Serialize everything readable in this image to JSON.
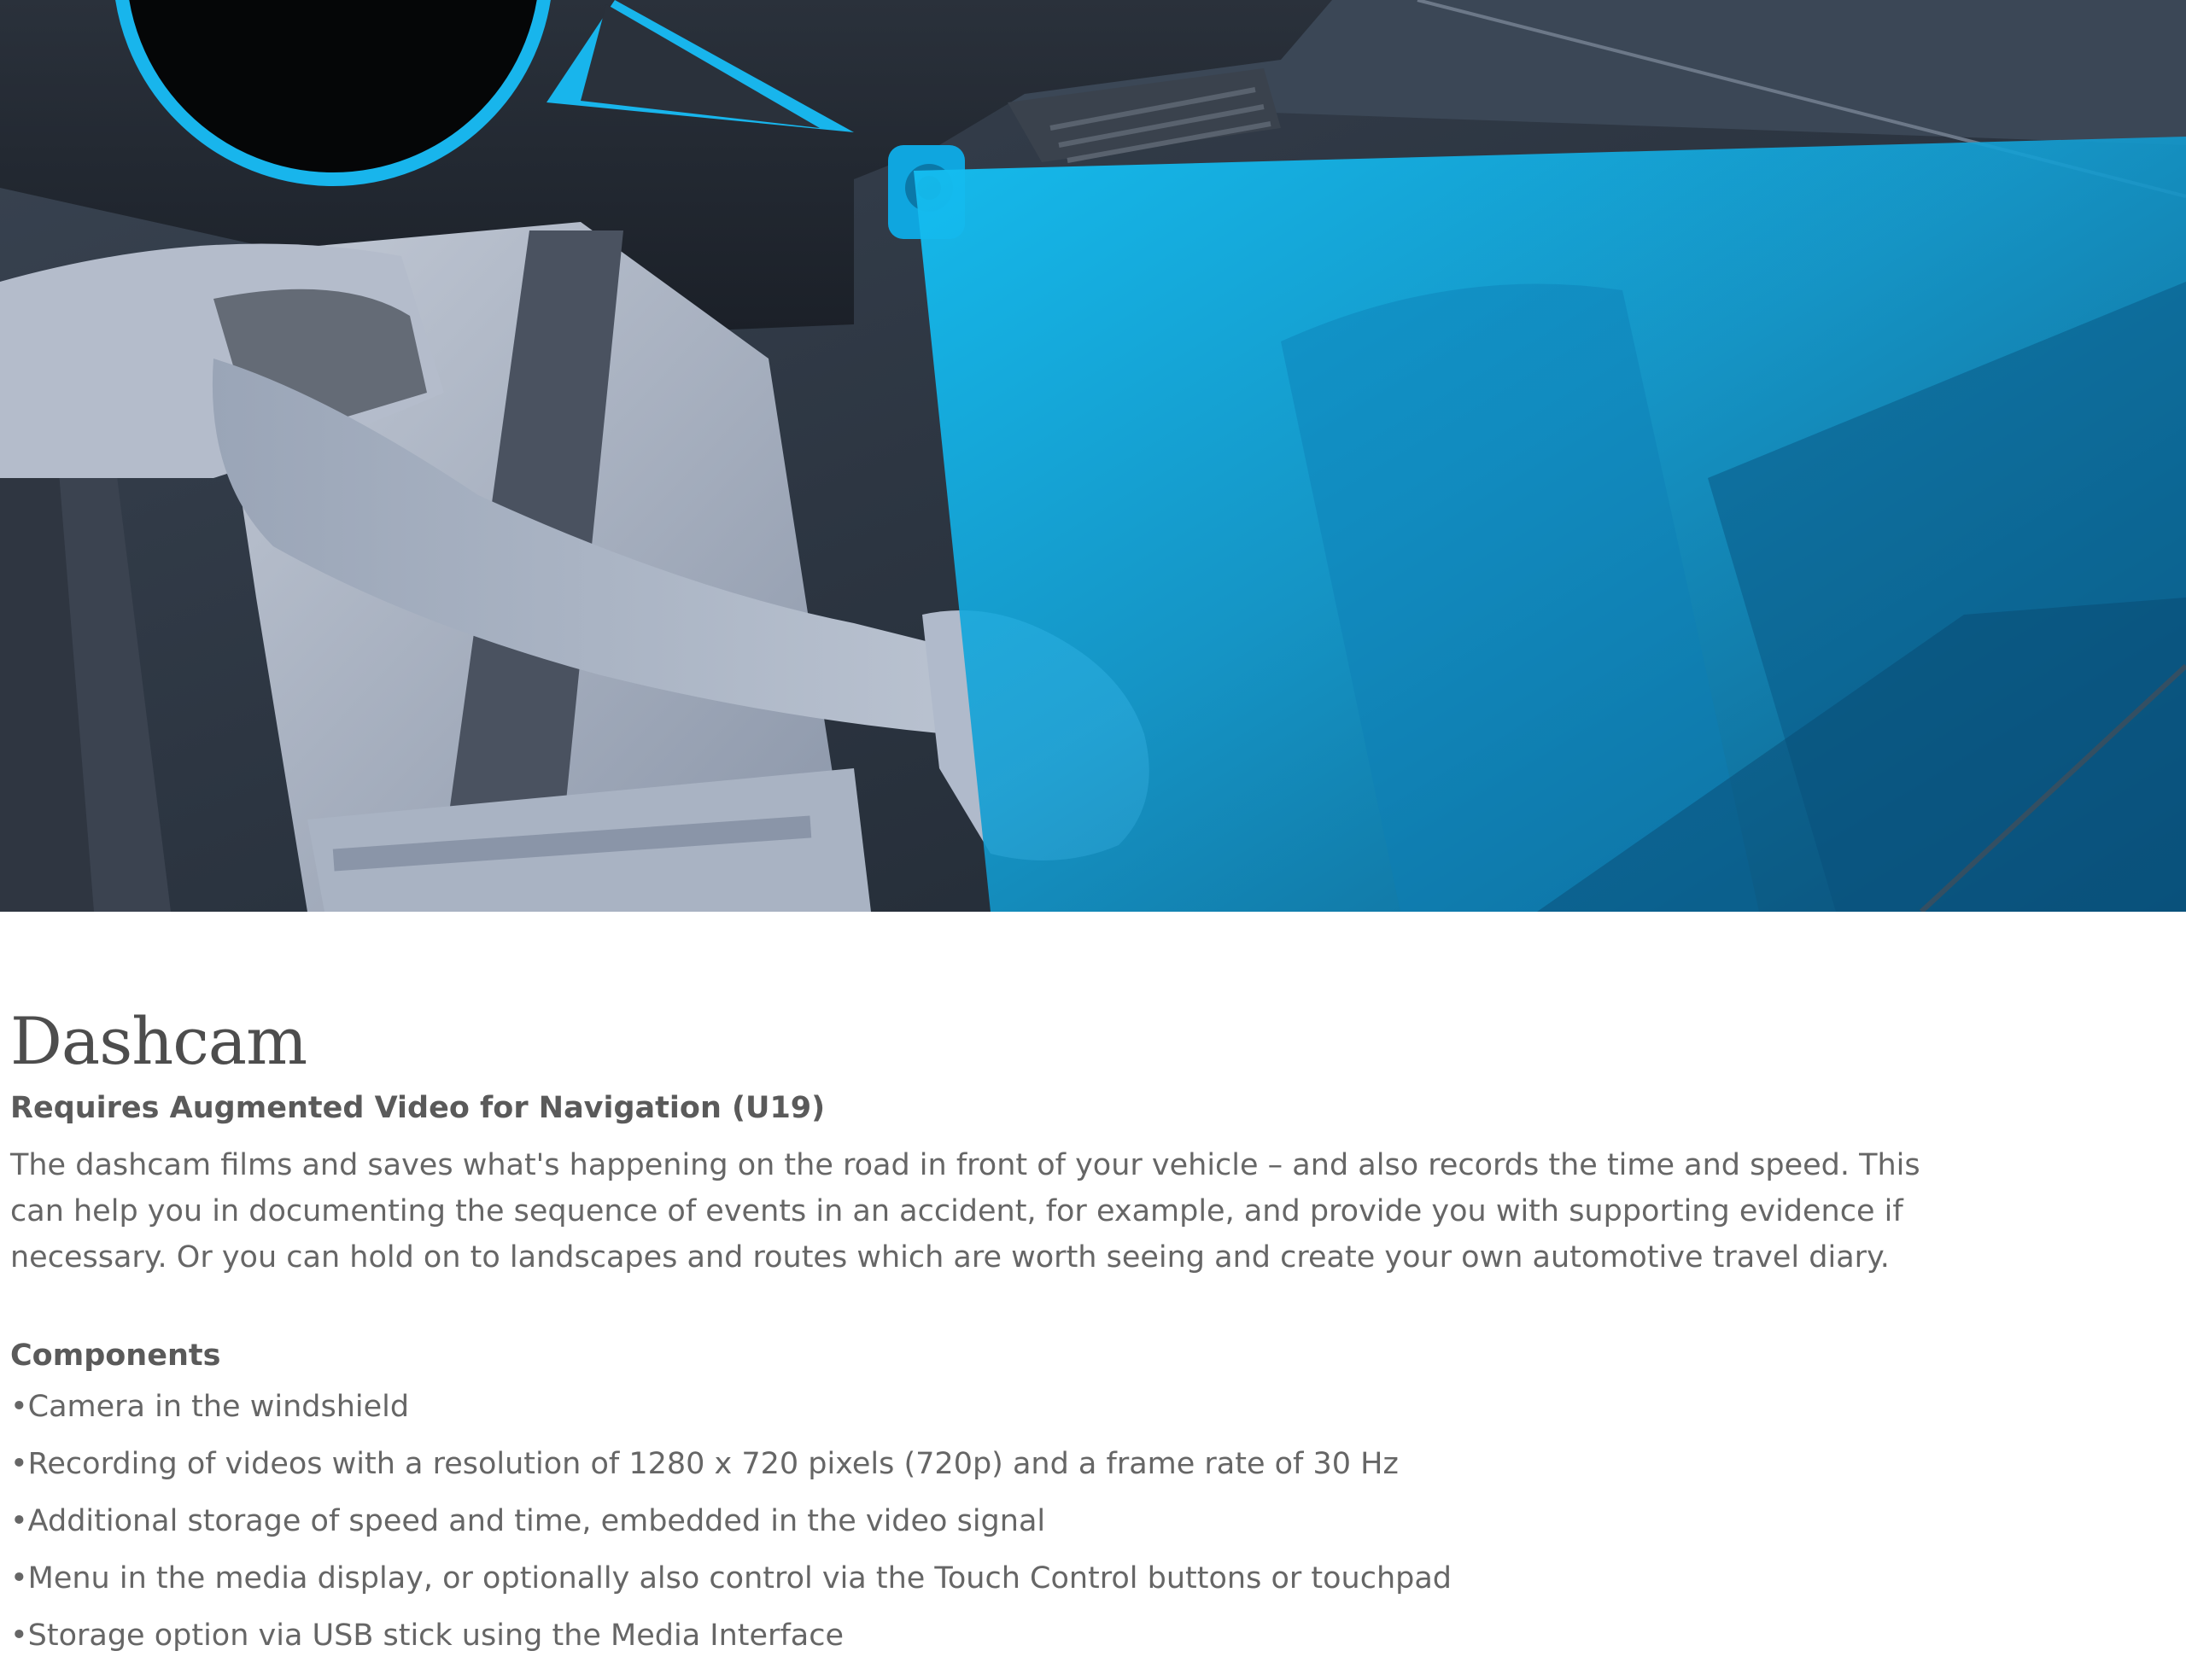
{
  "hero": {
    "accent_color": "#0fb4ea",
    "dark_color": "#2b3440",
    "figure_color": "#a9b3c3"
  },
  "main": {
    "title": "Dashcam",
    "subtitle": "Requires Augmented Video for Navigation (U19)",
    "description": "The dashcam films and saves what's happening on the road in front of your vehicle – and also records the time and speed. This can help you in documenting the sequence of events in an accident, for example, and provide you with supporting evidence if necessary. Or you can hold on to landscapes and routes which are worth seeing and create your own automotive travel diary.",
    "components_heading": "Components",
    "components": [
      "•Camera in the windshield",
      "•Recording of videos with a resolution of 1280 x 720 pixels (720p) and a frame rate of 30 Hz",
      "•Additional storage of speed and time, embedded in the video signal",
      "•Menu in the media display, or optionally also control via the Touch Control buttons or touchpad",
      "•Storage option via USB stick using the Media Interface"
    ]
  }
}
